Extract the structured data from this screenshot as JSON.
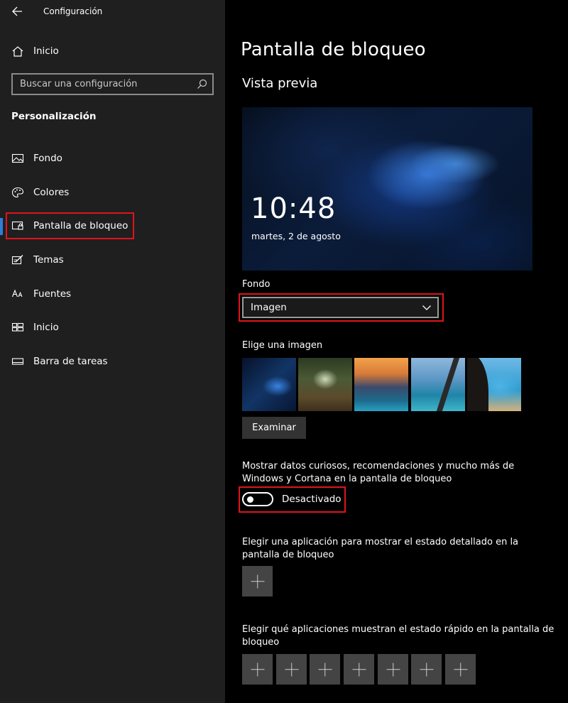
{
  "app": {
    "title": "Configuración"
  },
  "sidebar": {
    "home_label": "Inicio",
    "search_placeholder": "Buscar una configuración",
    "section_header": "Personalización",
    "items": [
      {
        "label": "Fondo",
        "icon": "image-icon"
      },
      {
        "label": "Colores",
        "icon": "palette-icon"
      },
      {
        "label": "Pantalla de bloqueo",
        "icon": "lock-screen-icon",
        "selected": true
      },
      {
        "label": "Temas",
        "icon": "themes-icon"
      },
      {
        "label": "Fuentes",
        "icon": "fonts-icon"
      },
      {
        "label": "Inicio",
        "icon": "start-icon"
      },
      {
        "label": "Barra de tareas",
        "icon": "taskbar-icon"
      }
    ]
  },
  "main": {
    "page_title": "Pantalla de bloqueo",
    "preview_title": "Vista previa",
    "preview_time": "10:48",
    "preview_date": "martes, 2 de agosto",
    "background_label": "Fondo",
    "background_value": "Imagen",
    "choose_image_label": "Elige una imagen",
    "browse_button": "Examinar",
    "fun_facts_text": "Mostrar datos curiosos, recomendaciones y mucho más de Windows y Cortana en la pantalla de bloqueo",
    "fun_facts_state": "Desactivado",
    "detailed_status_text": "Elegir una aplicación para mostrar el estado detallado en la pantalla de bloqueo",
    "quick_status_text": "Elegir qué aplicaciones muestran el estado rápido en la pantalla de bloqueo"
  },
  "colors": {
    "accent": "#2f7ed8",
    "highlight": "#e0141b"
  }
}
